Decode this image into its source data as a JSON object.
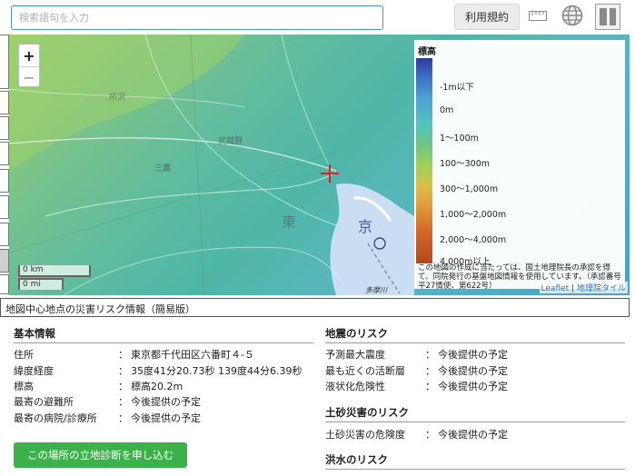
{
  "toolbar": {
    "search_placeholder": "検索語句を入力",
    "terms_label": "利用規約",
    "icons": [
      "ruler-icon",
      "globe-icon",
      "split-panes-icon"
    ]
  },
  "map": {
    "zoom_in": "+",
    "zoom_out": "−",
    "scale_km": "0 km",
    "scale_mi": "0 mi",
    "place_labels": {
      "kyo": "京",
      "tama": "多摩川"
    },
    "attribution": {
      "leaflet": "Leaflet",
      "gsi": "地理院タイル",
      "separator": "|"
    }
  },
  "legend": {
    "title": "標高",
    "items": [
      "-1m以下",
      "0m",
      "1～100m",
      "100～300m",
      "300～1,000m",
      "1,000～2,000m",
      "2,000～4,000m",
      "4,000m以上"
    ],
    "note": "この地図の作成に当たっては、国土地理院長の承認を得て、同院発行の基盤地図情報を使用しています。（承認番号　平27情使、第622号）",
    "colors": [
      "#2f3a9a",
      "#4ea3d2",
      "#52c2c0",
      "#9bd05a",
      "#d8c14a",
      "#e39a3a",
      "#d06a2c",
      "#b2481e"
    ]
  },
  "info": {
    "header": "地図中心地点の災害リスク情報（簡易版）",
    "basic": {
      "title": "基本情報",
      "rows": [
        {
          "key": "住所",
          "value": "東京都千代田区六番町４-５"
        },
        {
          "key": "緯度経度",
          "value": "35度41分20.73秒 139度44分6.39秒"
        },
        {
          "key": "標高",
          "value": "標高20.2m"
        },
        {
          "key": "最寄の避難所",
          "value": "今後提供の予定"
        },
        {
          "key": "最寄の病院/診療所",
          "value": "今後提供の予定"
        }
      ]
    },
    "earthquake": {
      "title": "地震のリスク",
      "rows": [
        {
          "key": "予測最大震度",
          "value": "今後提供の予定"
        },
        {
          "key": "最も近くの活断層",
          "value": "今後提供の予定"
        },
        {
          "key": "液状化危険性",
          "value": "今後提供の予定"
        }
      ]
    },
    "landslide": {
      "title": "土砂災害のリスク",
      "rows": [
        {
          "key": "土砂災害の危険度",
          "value": "今後提供の予定"
        }
      ]
    },
    "flood": {
      "title": "洪水のリスク"
    },
    "separator": "：",
    "cta_label": "この場所の立地診断を申し込む"
  },
  "colors": {
    "accent_green": "#3cb14a",
    "search_border": "#4a90c8",
    "crosshair": "#e02020"
  }
}
